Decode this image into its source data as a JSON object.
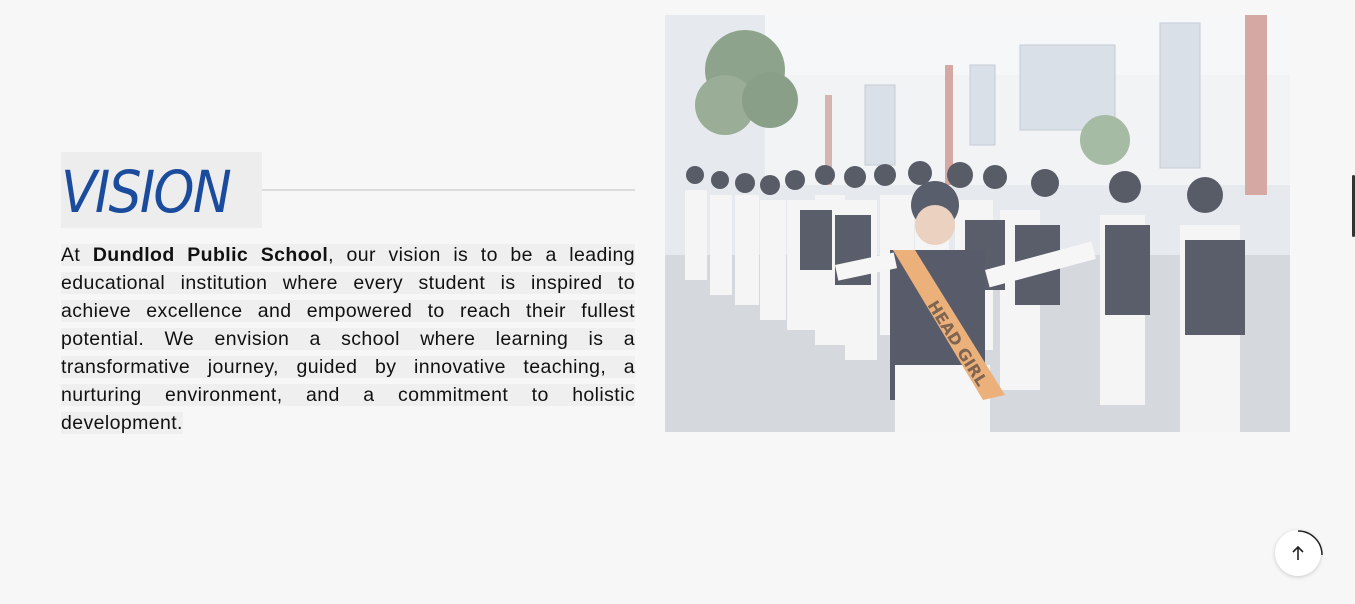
{
  "vision": {
    "title": "VISION",
    "intro": "At ",
    "school_name": "Dundlod Public School",
    "body": ", our vision is to be a leading educational institution where every student is inspired to achieve excellence and empowered to reach their fullest potential. We envision a school where learning is a transformative journey, guided by innovative teaching, a nurturing environment, and a commitment to holistic development."
  },
  "photo": {
    "sash_text": "HEAD GIRL"
  },
  "scroll_top": {
    "icon": "arrow-up-icon"
  }
}
